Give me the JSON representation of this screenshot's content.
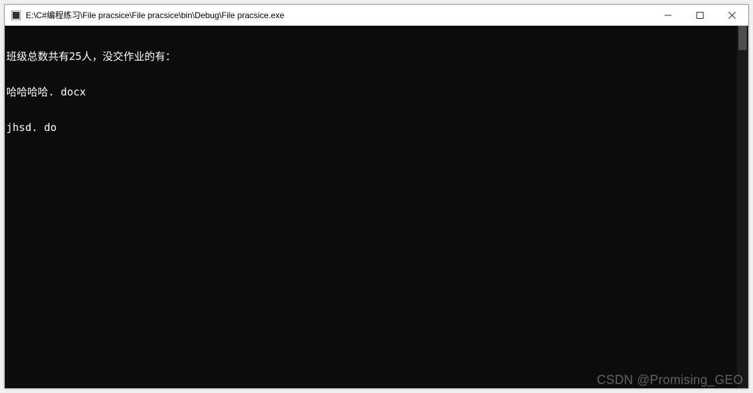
{
  "titlebar": {
    "path": "E:\\C#编程练习\\File pracsice\\File pracsice\\bin\\Debug\\File pracsice.exe"
  },
  "console": {
    "lines": [
      "班级总数共有25人，没交作业的有：",
      "哈哈哈哈. docx",
      "jhsd. do"
    ]
  },
  "watermark": "CSDN @Promising_GEO"
}
